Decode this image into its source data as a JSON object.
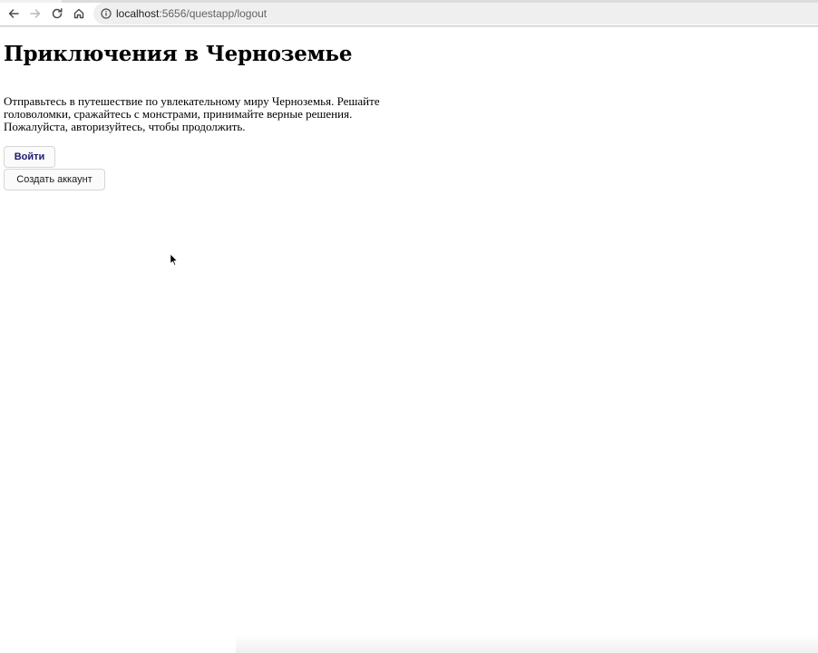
{
  "browser": {
    "url_host": "localhost",
    "url_path": ":5656/questapp/logout",
    "icons": {
      "back": "arrow-left-icon",
      "forward": "arrow-right-icon",
      "reload": "reload-icon",
      "home": "home-icon",
      "site_info": "info-icon"
    }
  },
  "page": {
    "title": "Приключения в Черноземье",
    "intro_lines": [
      "Отправьтесь в путешествие по увлекательному миру Черноземья. Решайте",
      "головоломки, сражайтесь с монстрами, принимайте верные решения.",
      "Пожалуйста, авторизуйтесь, чтобы продолжить."
    ],
    "login_label": "Войти",
    "register_label": "Создать аккаунт"
  },
  "colors": {
    "login_text": "#1a1a6e",
    "button_border": "#d6d6d6",
    "omnibox_bg": "#efefef"
  }
}
